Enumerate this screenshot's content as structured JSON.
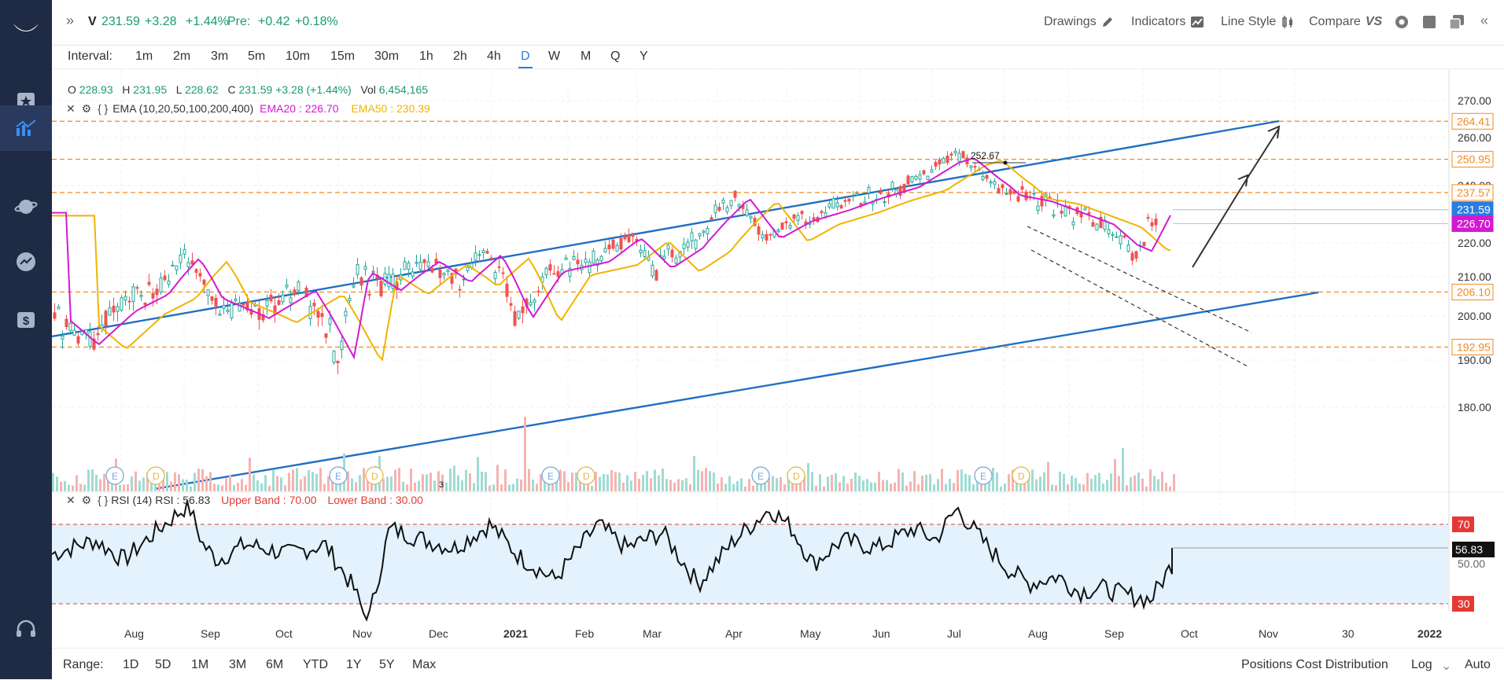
{
  "ticker": {
    "symbol": "V",
    "price": "231.59",
    "change": "+3.28",
    "change_pct": "+1.44%",
    "pre_label": "Pre:",
    "pre_change": "+0.42",
    "pre_pct": "+0.18%"
  },
  "toolbar": {
    "drawings": "Drawings",
    "indicators": "Indicators",
    "line_style": "Line Style",
    "compare": "Compare"
  },
  "intervals": {
    "label": "Interval:",
    "items": [
      "1m",
      "2m",
      "3m",
      "5m",
      "10m",
      "15m",
      "30m",
      "1h",
      "2h",
      "4h",
      "D",
      "W",
      "M",
      "Q",
      "Y"
    ],
    "active": "D"
  },
  "ohlc": {
    "o_label": "O",
    "o": "228.93",
    "h_label": "H",
    "h": "231.95",
    "l_label": "L",
    "l": "228.62",
    "c_label": "C",
    "c": "231.59",
    "chg": "+3.28 (+1.44%)",
    "vol_label": "Vol",
    "vol": "6,454,165"
  },
  "ema": {
    "label": "EMA (10,20,50,100,200,400)",
    "ema20": "EMA20 : 226.70",
    "ema50": "EMA50 : 230.39",
    "ema20_color": "#d21ad2",
    "ema50_color": "#f0b400"
  },
  "rsi": {
    "label": "RSI (14)",
    "value": "RSI : 56.83",
    "upper": "Upper Band : 70.00",
    "lower": "Lower Band : 30.00",
    "badge": "56.83",
    "upper_badge": "70",
    "lower_badge": "30",
    "axis": "50.00"
  },
  "price_axis": [
    "270.00",
    "260.00",
    "240.00",
    "220.00",
    "210.00",
    "200.00",
    "190.00",
    "180.00"
  ],
  "price_badges": [
    {
      "value": "264.41",
      "kind": "level"
    },
    {
      "value": "250.95",
      "kind": "level"
    },
    {
      "value": "237.57",
      "kind": "level"
    },
    {
      "value": "231.59",
      "kind": "current"
    },
    {
      "value": "226.70",
      "kind": "ema20"
    },
    {
      "value": "206.10",
      "kind": "level"
    },
    {
      "value": "192.95",
      "kind": "level"
    }
  ],
  "annotation": {
    "high": "252.67",
    "low_partial": "3"
  },
  "time_axis": [
    "Aug",
    "Sep",
    "Oct",
    "Nov",
    "Dec",
    "2021",
    "Feb",
    "Mar",
    "Apr",
    "May",
    "Jun",
    "Jul",
    "Aug",
    "Sep",
    "Oct",
    "Nov",
    "30",
    "2022"
  ],
  "earnings_markers": [
    "E",
    "D",
    "E",
    "D",
    "E",
    "D",
    "E",
    "D",
    "E",
    "D"
  ],
  "range": {
    "label": "Range:",
    "items": [
      "1D",
      "5D",
      "1M",
      "3M",
      "6M",
      "YTD",
      "1Y",
      "5Y",
      "Max"
    ]
  },
  "bottom_right": {
    "positions": "Positions Cost Distribution",
    "log": "Log",
    "auto": "Auto"
  },
  "colors": {
    "up": "#26a69a",
    "down": "#ef5350",
    "accent": "#2a7de1",
    "channel": "#1f6fc4",
    "level": "#f08a24",
    "rsi_band": "#e3f2fd",
    "rsi_dash": "#e53935",
    "sidebar": "#1f2a44"
  }
}
